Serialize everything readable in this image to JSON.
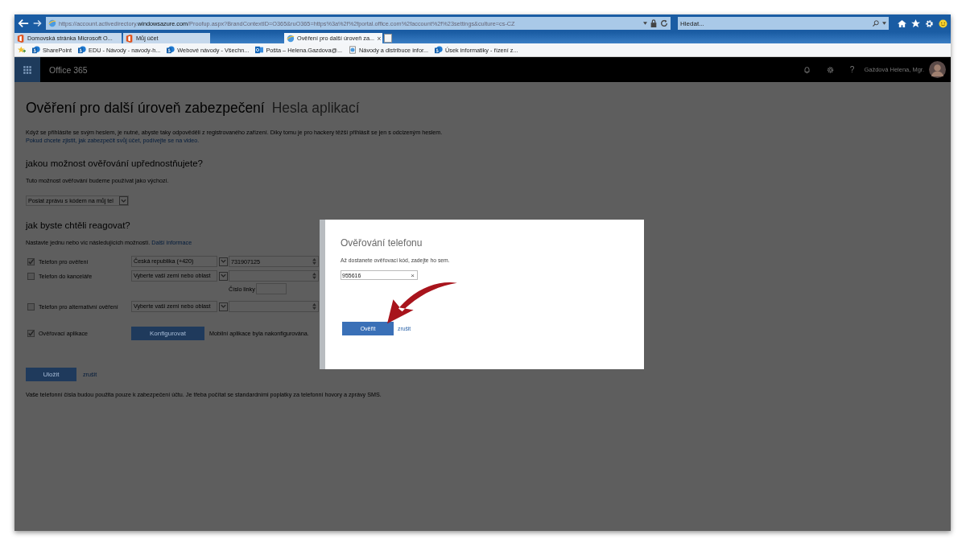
{
  "browser": {
    "url": "https://account.activedirectory.**windowsazure.com**/Proofup.aspx?BrandContextID=O365&ruO365=https%3a%2f%2fportal.office.com%2faccount%2f%23settings&culture=cs-CZ",
    "search": {
      "placeholder": "Hledat..."
    },
    "tabs": [
      {
        "label": "Domovská stránka Microsoft O...",
        "kind": "office",
        "selected": false
      },
      {
        "label": "Můj účet",
        "kind": "office",
        "selected": false
      },
      {
        "label": "Ověření pro další úroveň za...",
        "kind": "ie",
        "selected": true,
        "close": "×"
      }
    ],
    "favorites": [
      {
        "label": "SharePoint",
        "kind": "sharepoint"
      },
      {
        "label": "EDU - Návody - navody-h...",
        "kind": "sharepoint"
      },
      {
        "label": "Webové návody - Všechn...",
        "kind": "sharepoint"
      },
      {
        "label": "Pošta – Helena.Gazdova@...",
        "kind": "outlook"
      },
      {
        "label": "Návody a distribuce infor...",
        "kind": "page"
      },
      {
        "label": "Úsek informatiky - řízení z...",
        "kind": "sharepoint"
      }
    ]
  },
  "header": {
    "app": "Office 365",
    "help": "?",
    "user": "Gaždová Helena, Mgr."
  },
  "page": {
    "title": "Ověření pro další úroveň zabezpečení",
    "tab_link": "Hesla aplikací",
    "intro": "Když se přihlásíte se svým heslem, je nutné, abyste taky odpověděli z registrovaného zařízení. Díky tomu je pro hackery těžší přihlásit se jen s odcizeným heslem.",
    "intro_link": "Pokud chcete zjistit, jak zabezpečit svůj účet, podívejte se na video.",
    "default_heading": "jakou možnost ověřování upřednostňujete?",
    "default_text": "Tuto možnost ověřování budeme používat jako výchozí.",
    "default_option": "Poslat zprávu s kódem na můj tel",
    "methods_heading": "jak byste chtěli reagovat?",
    "methods_text": "Nastavte jednu nebo víc následujících možností.",
    "methods_link": "Další informace",
    "methods": [
      {
        "kind": "phone",
        "label": "Telefon pro ověření",
        "checked": true,
        "country": "Česká republika (+420)",
        "number": "731907125"
      },
      {
        "kind": "phone",
        "label": "Telefon do kanceláře",
        "checked": false,
        "country": "Vyberte vaši zemi nebo oblast",
        "extension_label": "Číslo linky"
      },
      {
        "kind": "phone",
        "label": "Telefon pro alternativní ověření",
        "checked": false,
        "country": "Vyberte vaši zemi nebo oblast"
      },
      {
        "kind": "app",
        "label": "Ověřovací aplikace",
        "checked": true,
        "button": "Konfigurovat",
        "status": "Mobilní aplikace byla nakonfigurována."
      }
    ],
    "save": "Uložit",
    "cancel": "zrušit",
    "footer": "Vaše telefonní čísla budou použita pouze k zabezpečení účtu. Je třeba počítat se standardními poplatky za telefonní hovory a zprávy SMS."
  },
  "dialog": {
    "title": "Ověřování telefonu",
    "text": "Až dostanete ověřovací kód, zadejte ho sem.",
    "code": "955616",
    "clear": "×",
    "verify": "Ověřit",
    "cancel": "zrušit"
  }
}
